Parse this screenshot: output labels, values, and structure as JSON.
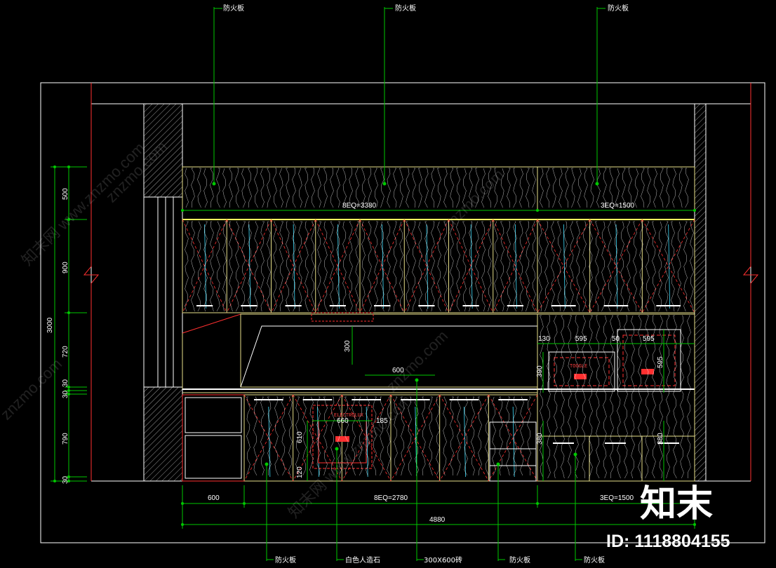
{
  "colors": {
    "background": "#000000",
    "outline": "#ffffff",
    "panel": "#e8e08a",
    "dim": "#00c800",
    "leader": "#00c800",
    "accent_red": "#ff3030",
    "accent_cyan": "#40e0ff",
    "grain": "#ffffff"
  },
  "callouts_top": [
    {
      "label": "防火板"
    },
    {
      "label": "防火板"
    },
    {
      "label": "防火板"
    }
  ],
  "callouts_bottom": [
    {
      "label": "防火板"
    },
    {
      "label": "白色人造石"
    },
    {
      "label": "300X600砖"
    },
    {
      "label": "防火板"
    },
    {
      "label": "防火板"
    }
  ],
  "dims_vertical": [
    "3000",
    "500",
    "900",
    "720",
    "30",
    "30",
    "790",
    "30"
  ],
  "dims_horizontal_row1": [
    "600",
    "8EQ=2780",
    "3EQ=1500"
  ],
  "dims_horizontal_total": "4880",
  "dims_upper": [
    "8EQ=3380",
    "3EQ=1500"
  ],
  "dims_inner": [
    "300",
    "600",
    "130",
    "595",
    "50",
    "595",
    "390",
    "595",
    "660",
    "185",
    "610",
    "120",
    "380",
    "380"
  ],
  "red_text": [
    "ELECTROLUX",
    "TOGGLE"
  ],
  "watermark_text": "znzmo.com",
  "watermark_cn": "知末网 www.znzmo.com",
  "logo_text": "知末",
  "id_text": "ID: 1118804155"
}
